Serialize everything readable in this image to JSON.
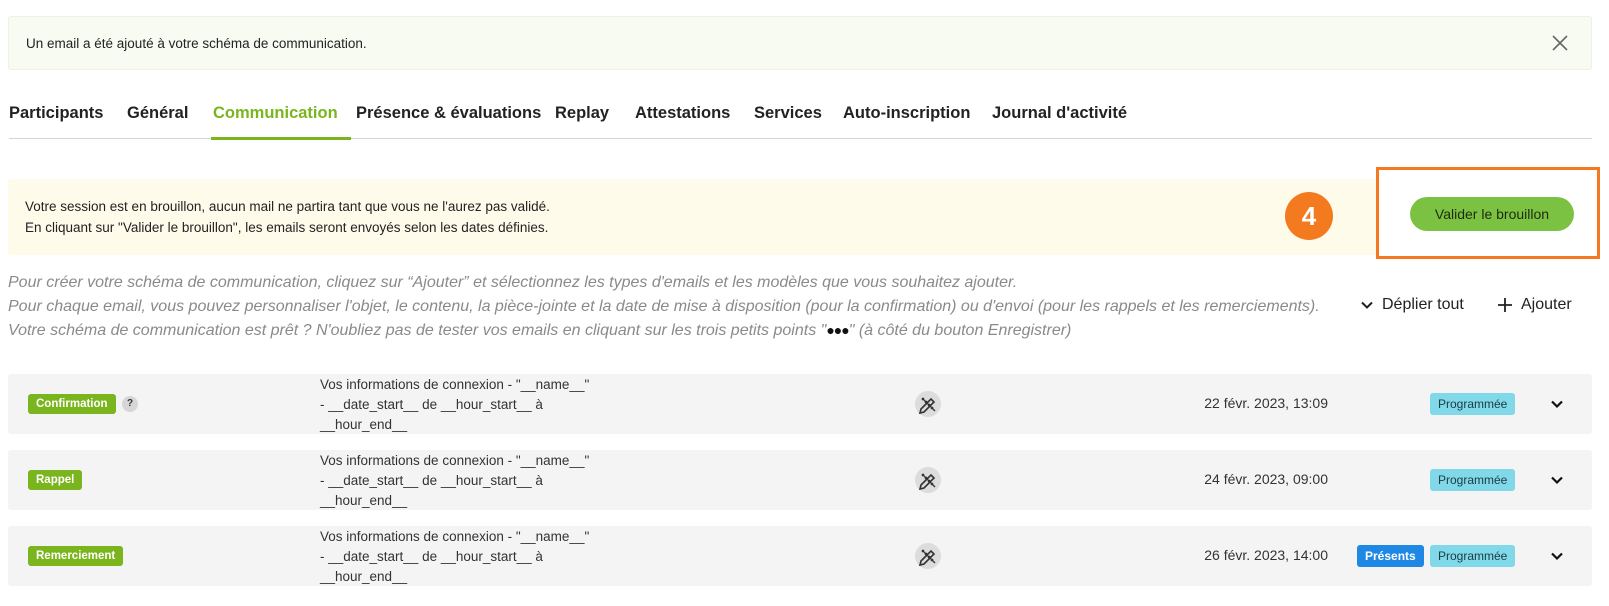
{
  "banner": {
    "text": "Un email a été ajouté à votre schéma de communication.",
    "close_icon": "close-icon"
  },
  "tabs": [
    {
      "label": "Participants"
    },
    {
      "label": "Général"
    },
    {
      "label": "Communication",
      "active": true
    },
    {
      "label": "Présence & évaluations"
    },
    {
      "label": "Replay"
    },
    {
      "label": "Attestations"
    },
    {
      "label": "Services"
    },
    {
      "label": "Auto-inscription"
    },
    {
      "label": "Journal d'activité"
    }
  ],
  "draft_notice": {
    "line1": "Votre session est en brouillon, aucun mail ne partira tant que vous ne l'aurez pas validé.",
    "line2": "En cliquant sur \"Valider le brouillon\", les emails seront envoyés selon les dates définies.",
    "step_number": "4",
    "validate_label": "Valider le brouillon"
  },
  "instructions": {
    "line1": "Pour créer votre schéma de communication, cliquez sur “Ajouter” et sélectionnez les types d'emails et les modèles que vous souhaitez ajouter.",
    "line2": "Pour chaque email, vous pouvez personnaliser l'objet, le contenu, la pièce-jointe et la date de mise à disposition (pour la confirmation) ou d'envoi (pour les rappels et les remerciements).",
    "line3_before": "Votre schéma de communication est prêt ? N'oubliez pas de tester vos emails en cliquant sur les trois petits points \"",
    "line3_dots": "●●●",
    "line3_after": "\" (à côté du bouton Enregistrer)"
  },
  "actions": {
    "expand_all": "Déplier tout",
    "add": "Ajouter"
  },
  "emails": [
    {
      "type": "Confirmation",
      "help": "?",
      "subject_line1": "Vos informations de connexion - \"__name__\"",
      "subject_line2": "- __date_start__ de __hour_start__ à",
      "subject_line3": "__hour_end__",
      "date": "22 févr. 2023, 13:09",
      "status": "Programmée"
    },
    {
      "type": "Rappel",
      "subject_line1": "Vos informations de connexion - \"__name__\"",
      "subject_line2": "- __date_start__ de __hour_start__ à",
      "subject_line3": "__hour_end__",
      "date": "24 févr. 2023, 09:00",
      "status": "Programmée"
    },
    {
      "type": "Remerciement",
      "subject_line1": "Vos informations de connexion - \"__name__\"",
      "subject_line2": "- __date_start__ de __hour_start__ à",
      "subject_line3": "__hour_end__",
      "date": "26 févr. 2023, 14:00",
      "audience": "Présents",
      "status": "Programmée"
    }
  ],
  "colors": {
    "accent_green": "#7ab51d",
    "button_green": "#7cc242",
    "highlight_orange": "#f47a1f",
    "status_cyan": "#80d8e8",
    "audience_blue": "#1f88e5"
  }
}
